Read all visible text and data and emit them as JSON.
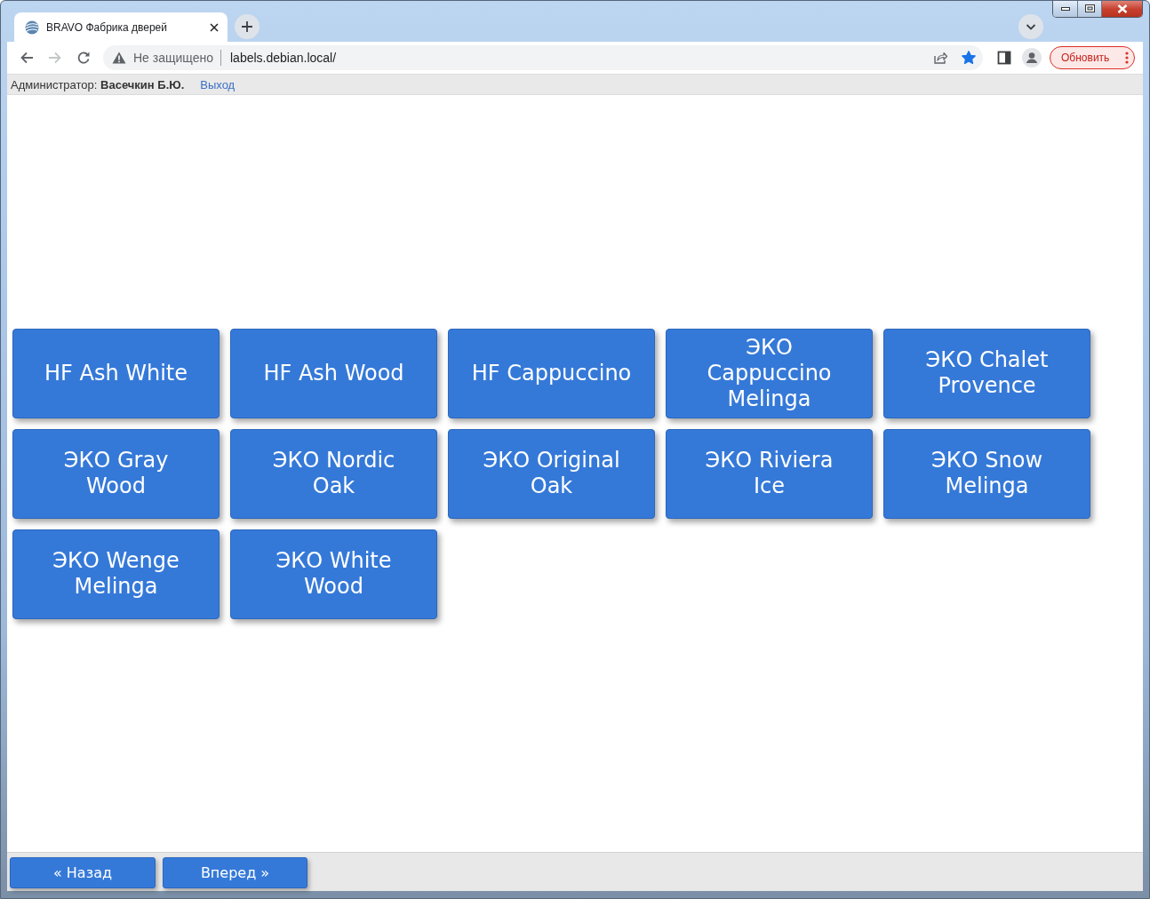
{
  "browser": {
    "tab": {
      "title": "BRAVO Фабрика дверей"
    },
    "navigation": {
      "back_disabled": false,
      "forward_disabled": true
    },
    "address_bar": {
      "security_label": "Не защищено",
      "url": "labels.debian.local/",
      "bookmarked": true
    },
    "update_button": "Обновить"
  },
  "user_bar": {
    "user": "Администратор: **Васечкин Б.Ю.**",
    "logout_link": "Выход"
  },
  "products": [
    "HF Ash White",
    "HF Ash Wood",
    "HF Cappuccino",
    "ЭКО Cappuccino Melinga",
    "ЭКО Chalet Provence",
    "ЭКО Gray Wood",
    "ЭКО Nordic Oak",
    "ЭКО Original Oak",
    "ЭКО Riviera Ice",
    "ЭКО Snow Melinga",
    "ЭКО Wenge Melinga",
    "ЭКО White Wood"
  ],
  "pager": {
    "back": "« Назад",
    "forward": "Вперед »"
  }
}
